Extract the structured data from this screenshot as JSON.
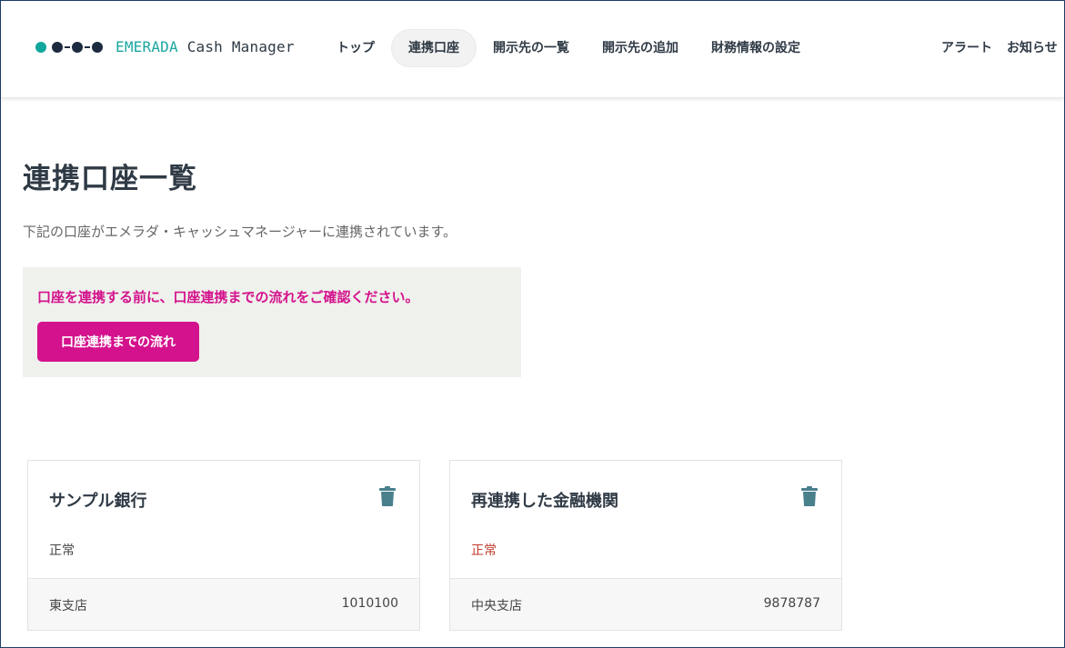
{
  "header": {
    "logo_brand": "EMERADA",
    "logo_product": "Cash Manager",
    "nav": [
      {
        "label": "トップ"
      },
      {
        "label": "連携口座"
      },
      {
        "label": "開示先の一覧"
      },
      {
        "label": "開示先の追加"
      },
      {
        "label": "財務情報の設定"
      }
    ],
    "right_links": [
      {
        "label": "アラート"
      },
      {
        "label": "お知らせ"
      }
    ]
  },
  "main": {
    "title": "連携口座一覧",
    "description": "下記の口座がエメラダ・キャッシュマネージャーに連携されています。",
    "notice": {
      "text": "口座を連携する前に、口座連携までの流れをご確認ください。",
      "button_label": "口座連携までの流れ"
    },
    "accounts": [
      {
        "bank": "サンプル銀行",
        "status": "正常",
        "branch": "東支店",
        "account_number": "1010100"
      },
      {
        "bank": "再連携した金融機関",
        "status": "正常",
        "branch": "中央支店",
        "account_number": "9878787"
      }
    ]
  },
  "colors": {
    "accent": "#d4128d",
    "brand_teal": "#12a79d",
    "text_dark": "#2f3a45",
    "notice_bg": "#eff1ec",
    "trash_icon": "#4a7f8c"
  },
  "icons": [
    "logo-dots-icon",
    "trash-icon"
  ]
}
